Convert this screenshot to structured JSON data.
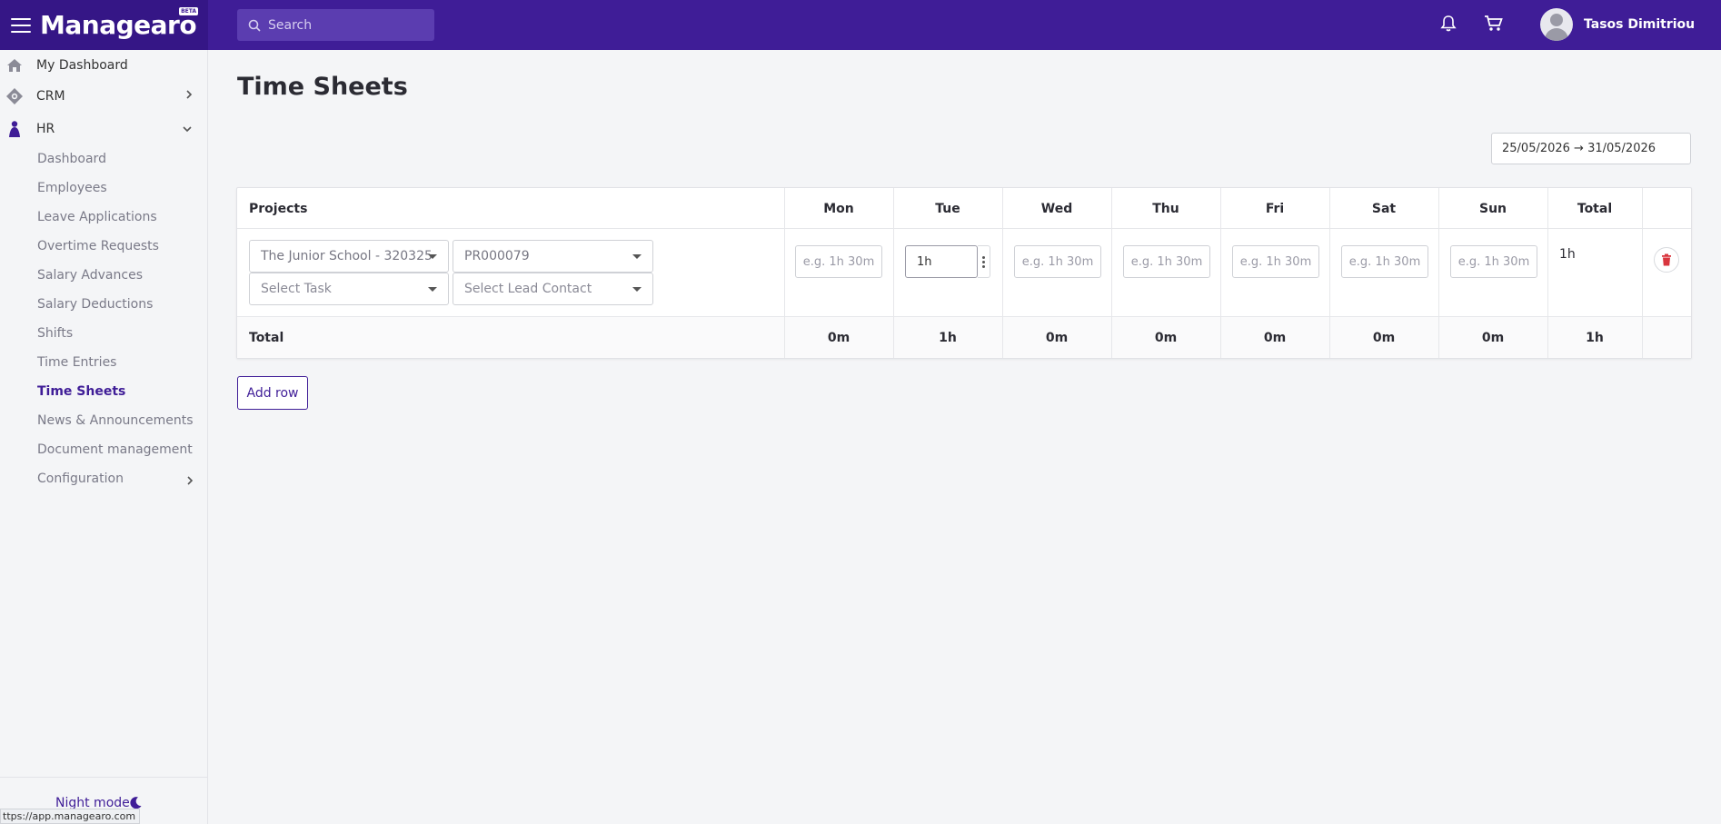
{
  "app": {
    "logo_text": "Managearo",
    "beta_badge": "BETA",
    "search_placeholder": "Search",
    "user_name": "Tasos Dimitriou"
  },
  "sidebar": {
    "items": [
      {
        "label": "My Dashboard",
        "icon": "home-icon"
      },
      {
        "label": "CRM",
        "icon": "crm-icon"
      },
      {
        "label": "HR",
        "icon": "hr-person-icon"
      }
    ],
    "hr_subitems": [
      "Dashboard",
      "Employees",
      "Leave Applications",
      "Overtime Requests",
      "Salary Advances",
      "Salary Deductions",
      "Shifts",
      "Time Entries",
      "Time Sheets",
      "News & Announcements",
      "Document management",
      "Configuration"
    ],
    "active_subitem": "Time Sheets",
    "night_mode_label": "Night mode"
  },
  "page": {
    "title": "Time Sheets",
    "date_range": "25/05/2026 → 31/05/2026",
    "add_row_label": "Add row"
  },
  "table": {
    "projects_header": "Projects",
    "days": [
      "Mon",
      "Tue",
      "Wed",
      "Thu",
      "Fri",
      "Sat",
      "Sun"
    ],
    "total_header": "Total",
    "row": {
      "project_value": "The Junior School - 320325",
      "project_code": "PR000079",
      "task_placeholder": "Select Task",
      "lead_contact_placeholder": "Select Lead Contact",
      "day_placeholder": "e.g. 1h 30m",
      "day_values": [
        "",
        "1h",
        "",
        "",
        "",
        "",
        ""
      ],
      "row_total": "1h"
    },
    "totals_label": "Total",
    "day_totals": [
      "0m",
      "1h",
      "0m",
      "0m",
      "0m",
      "0m",
      "0m"
    ],
    "grand_total": "1h"
  },
  "status_bar": {
    "url": "ttps://app.managearo.com"
  },
  "colors": {
    "brand": "#3f1d97",
    "brand_dark": "#351686",
    "delete": "#d9363e"
  }
}
